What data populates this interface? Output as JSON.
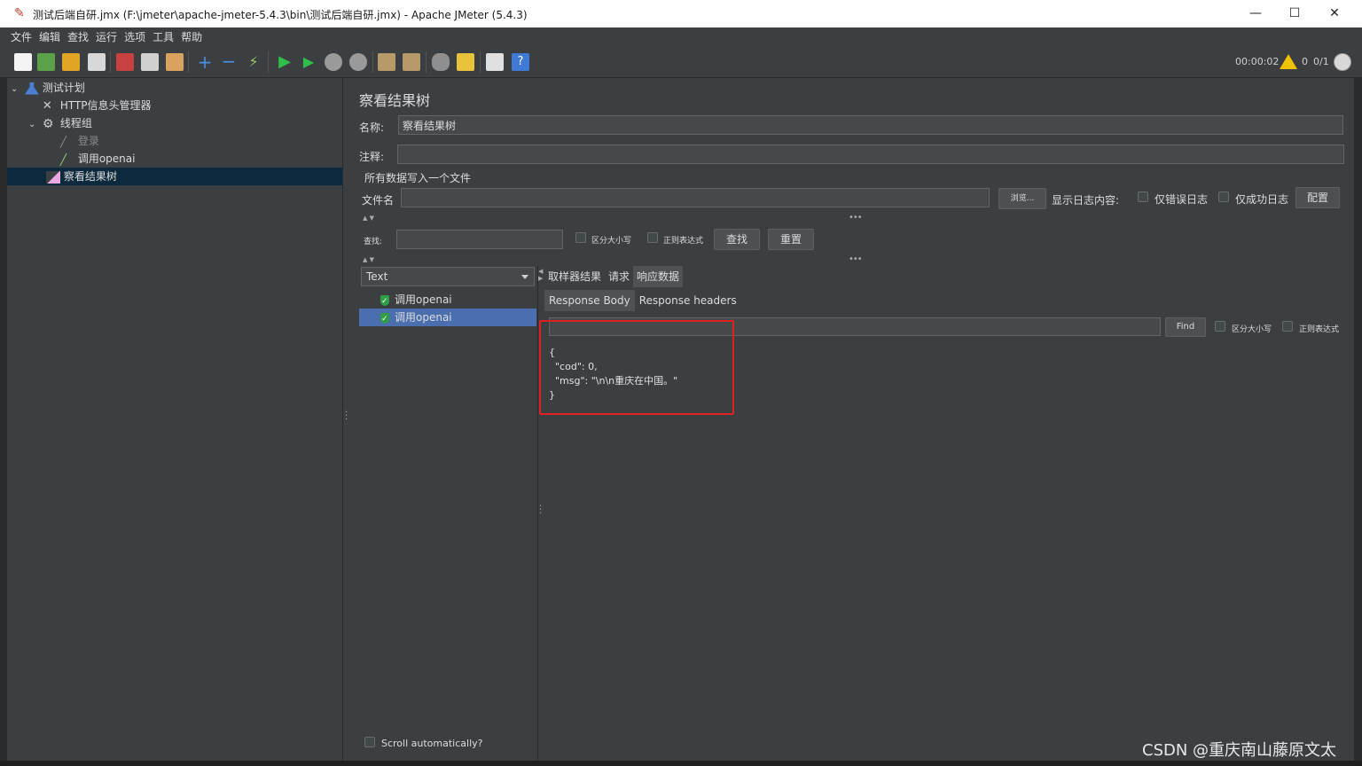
{
  "window": {
    "title": "测试后端自研.jmx (F:\\jmeter\\apache-jmeter-5.4.3\\bin\\测试后端自研.jmx) - Apache JMeter (5.4.3)",
    "minimize": "—",
    "maximize": "☐",
    "close": "✕"
  },
  "menu": [
    "文件",
    "编辑",
    "查找",
    "运行",
    "选项",
    "工具",
    "帮助"
  ],
  "status": {
    "elapsed": "00:00:02",
    "warnings": "0",
    "threads": "0/1"
  },
  "tree": {
    "items": [
      {
        "label": "测试计划",
        "icon": "flask-icon"
      },
      {
        "label": "HTTP信息头管理器",
        "icon": "wrench-icon"
      },
      {
        "label": "线程组",
        "icon": "gear-icon"
      },
      {
        "label": "登录",
        "icon": "pipette-icon"
      },
      {
        "label": "调用openai",
        "icon": "pipette-icon"
      },
      {
        "label": "察看结果树",
        "icon": "chart-icon"
      }
    ]
  },
  "panel": {
    "title": "察看结果树",
    "name_label": "名称:",
    "name_value": "察看结果树",
    "comment_label": "注释:",
    "comment_value": "",
    "file_group_title": "所有数据写入一个文件",
    "filename_label": "文件名",
    "filename_value": "",
    "browse": "浏览...",
    "log_label": "显示日志内容:",
    "errors_only": "仅错误日志",
    "success_only": "仅成功日志",
    "configure": "配置",
    "search_label": "查找:",
    "search_value": "",
    "case_sensitive": "区分大小写",
    "regex": "正则表达式",
    "find": "查找",
    "reset": "重置"
  },
  "results": {
    "renderer": "Text",
    "samples": [
      "调用openai",
      "调用openai"
    ],
    "scroll_auto": "Scroll automatically?"
  },
  "detail": {
    "tabs": [
      "取样器结果",
      "请求",
      "响应数据"
    ],
    "subtabs": [
      "Response Body",
      "Response headers"
    ],
    "find_value": "",
    "find_button": "Find",
    "case_sensitive": "区分大小写",
    "regex": "正则表达式",
    "body_lines": [
      "{",
      "  \"cod\": 0,",
      "  \"msg\": \"\\n\\n重庆在中国。\"",
      "}"
    ]
  },
  "watermark": "CSDN @重庆南山藤原文太",
  "colors": {
    "selection": "#4b6eaf",
    "tree_selection": "#0d293e",
    "highlight": "#e02020",
    "warning": "#f2c200"
  }
}
